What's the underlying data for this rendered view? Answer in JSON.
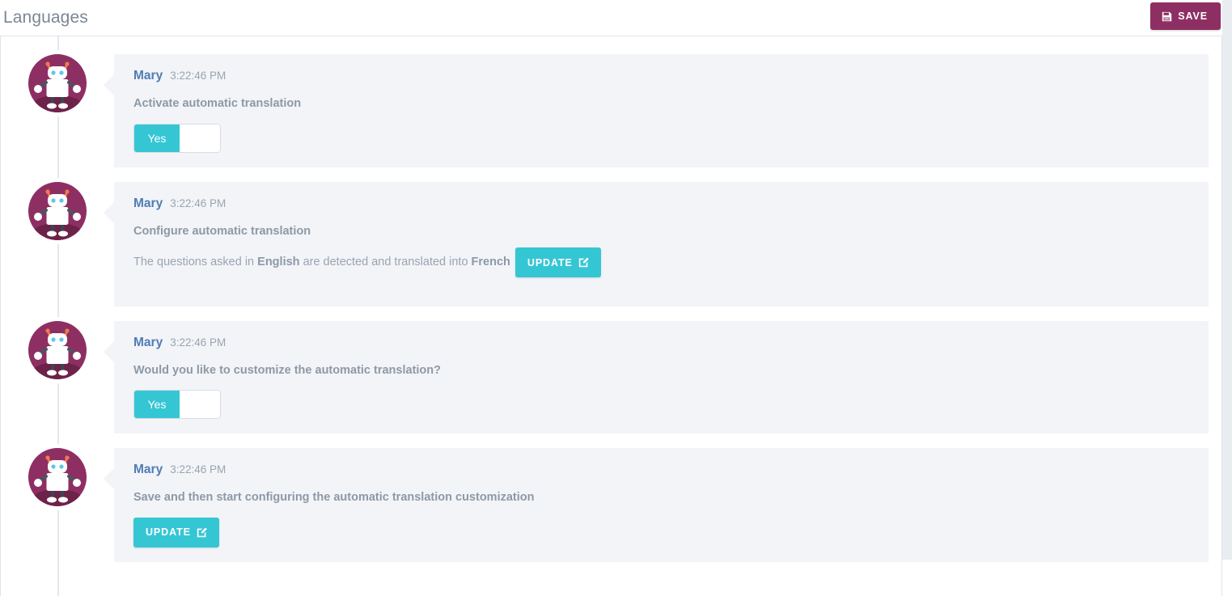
{
  "header": {
    "title": "Languages",
    "save_label": "SAVE",
    "save_icon": "floppy-disk-save-icon",
    "save_color": "#8e2f63"
  },
  "theme": {
    "accent_teal": "#35c6d4",
    "accent_magenta": "#8e2f63",
    "author_blue": "#4f7cb5",
    "bubble_background": "#f2f4f8",
    "text_muted": "#9aa5b1"
  },
  "avatar": {
    "icon": "robot-avatar-icon",
    "background": "#8e2f63"
  },
  "messages": [
    {
      "author": "Mary",
      "time": "3:22:46 PM",
      "label": "Activate automatic translation",
      "control": "toggle",
      "toggle_on_label": "Yes"
    },
    {
      "author": "Mary",
      "time": "3:22:46 PM",
      "label": "Configure automatic translation",
      "control": "sentence-with-update",
      "sentence": {
        "prefix": "The questions asked in",
        "source_language": "English",
        "middle": "are detected and translated into",
        "target_language": "French"
      },
      "update_label": "UPDATE",
      "update_icon": "edit-square-pencil-icon"
    },
    {
      "author": "Mary",
      "time": "3:22:46 PM",
      "label": "Would you like to customize the automatic translation?",
      "control": "toggle",
      "toggle_on_label": "Yes"
    },
    {
      "author": "Mary",
      "time": "3:22:46 PM",
      "label": "Save and then start configuring the automatic translation customization",
      "control": "update",
      "update_label": "UPDATE",
      "update_icon": "edit-square-pencil-icon"
    }
  ]
}
